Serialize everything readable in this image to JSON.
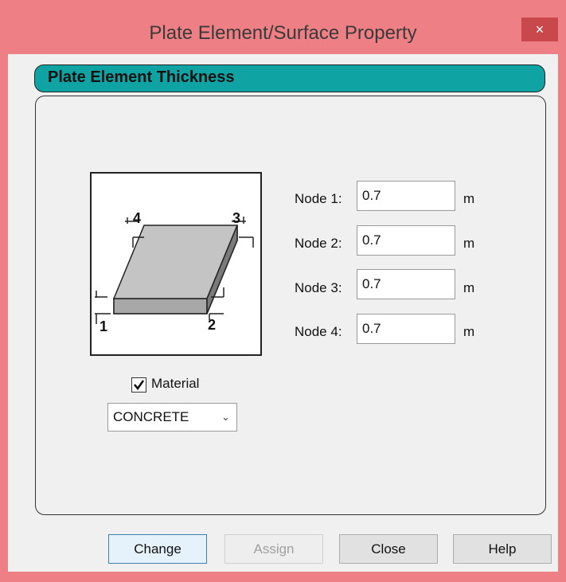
{
  "window": {
    "title": "Plate Element/Surface Property",
    "close_symbol": "×"
  },
  "section": {
    "header": "Plate Element Thickness"
  },
  "diagram": {
    "corner_labels": [
      "4",
      "3",
      "1",
      "2"
    ]
  },
  "nodes": [
    {
      "label": "Node 1:",
      "value": "0.7",
      "unit": "m"
    },
    {
      "label": "Node 2:",
      "value": "0.7",
      "unit": "m"
    },
    {
      "label": "Node 3:",
      "value": "0.7",
      "unit": "m"
    },
    {
      "label": "Node 4:",
      "value": "0.7",
      "unit": "m"
    }
  ],
  "material": {
    "label": "Material",
    "checked": true,
    "selected": "CONCRETE"
  },
  "buttons": {
    "change": "Change",
    "assign": "Assign",
    "close": "Close",
    "help": "Help"
  },
  "colors": {
    "frame": "#ee7f85",
    "header": "#0fa3a3",
    "client": "#f0f0f0"
  }
}
